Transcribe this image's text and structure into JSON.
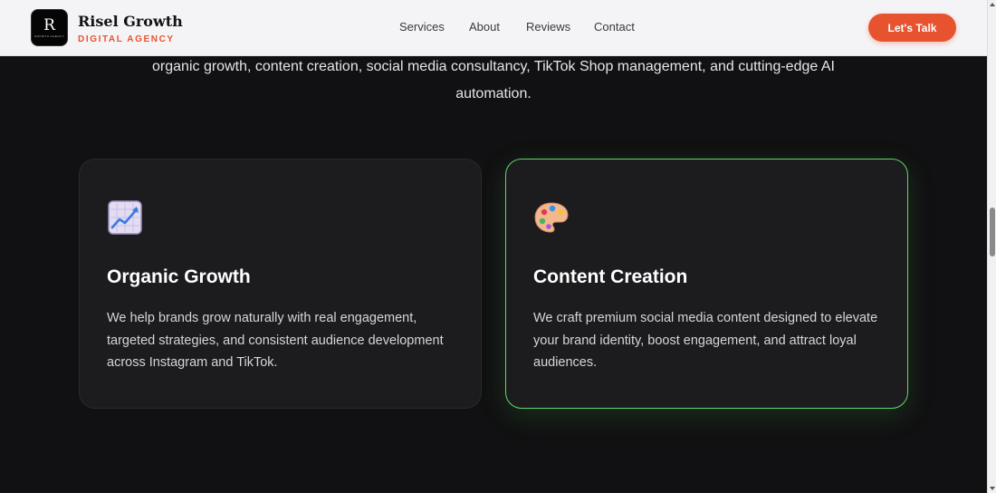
{
  "header": {
    "logo_mark": "R",
    "logo_mark_sub": "GROWTH AGENCY",
    "brand_name": "Risel Growth",
    "brand_tagline": "DIGITAL AGENCY",
    "nav": [
      {
        "label": "Services"
      },
      {
        "label": "About"
      },
      {
        "label": "Reviews"
      },
      {
        "label": "Contact"
      }
    ],
    "cta_label": "Let's Talk"
  },
  "intro": {
    "text": "organic growth, content creation, social media consultancy, TikTok Shop management, and cutting-edge AI automation."
  },
  "cards": [
    {
      "icon": "chart-increasing-icon",
      "title": "Organic Growth",
      "description": "We help brands grow naturally with real engagement, targeted strategies, and consistent audience development across Instagram and TikTok.",
      "highlighted": false
    },
    {
      "icon": "artist-palette-icon",
      "title": "Content Creation",
      "description": "We craft premium social media content designed to elevate your brand identity, boost engagement, and attract loyal audiences.",
      "highlighted": true
    }
  ],
  "colors": {
    "accent": "#e8532f",
    "highlight_border": "#5fd66a",
    "background": "#111012",
    "card_bg": "#1c1b1e",
    "header_bg": "#f4f4f6"
  }
}
